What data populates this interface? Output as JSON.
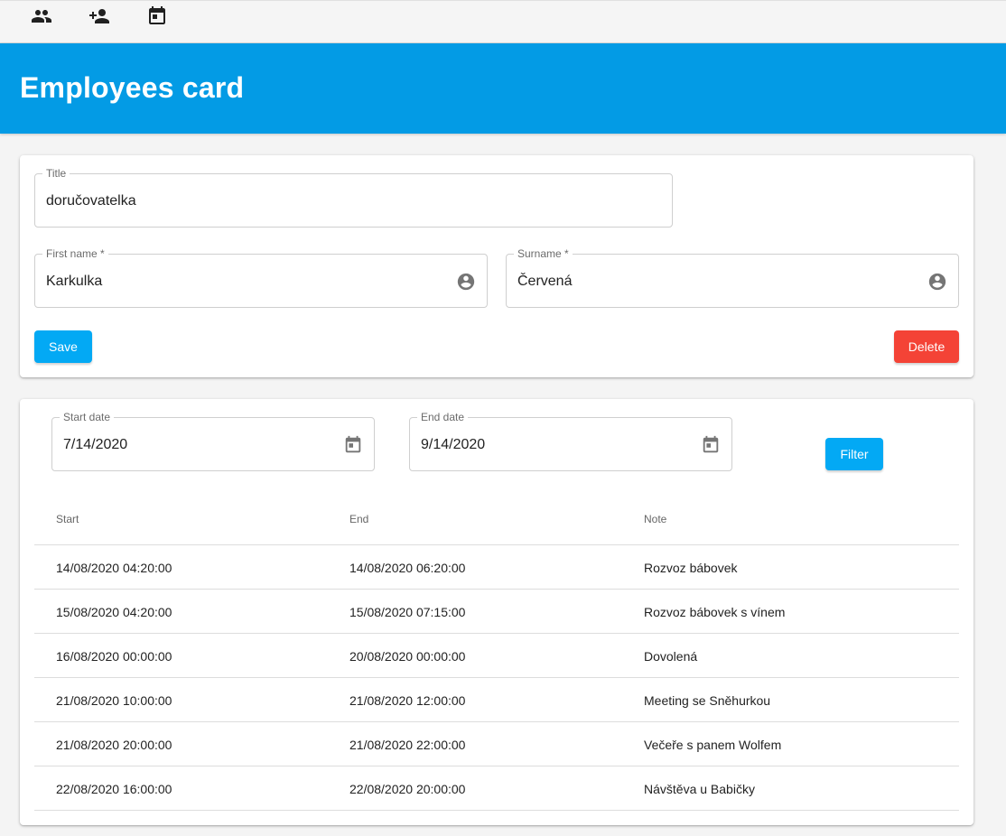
{
  "nav": {
    "icons": [
      "people-icon",
      "person-add-icon",
      "calendar-icon"
    ]
  },
  "header": {
    "title": "Employees card"
  },
  "form": {
    "title_field": {
      "label": "Title",
      "value": "doručovatelka"
    },
    "first_name_field": {
      "label": "First name *",
      "value": "Karkulka",
      "icon": "account-circle-icon"
    },
    "surname_field": {
      "label": "Surname *",
      "value": "Červená",
      "icon": "account-circle-icon"
    },
    "save_label": "Save",
    "delete_label": "Delete"
  },
  "filter": {
    "start_date": {
      "label": "Start date",
      "value": "7/14/2020",
      "icon": "calendar-icon"
    },
    "end_date": {
      "label": "End date",
      "value": "9/14/2020",
      "icon": "calendar-icon"
    },
    "filter_label": "Filter"
  },
  "table": {
    "columns": [
      "Start",
      "End",
      "Note"
    ],
    "rows": [
      [
        "14/08/2020 04:20:00",
        "14/08/2020 06:20:00",
        "Rozvoz bábovek"
      ],
      [
        "15/08/2020 04:20:00",
        "15/08/2020 07:15:00",
        "Rozvoz bábovek s vínem"
      ],
      [
        "16/08/2020 00:00:00",
        "20/08/2020 00:00:00",
        "Dovolená"
      ],
      [
        "21/08/2020 10:00:00",
        "21/08/2020 12:00:00",
        "Meeting se Sněhurkou"
      ],
      [
        "21/08/2020 20:00:00",
        "21/08/2020 22:00:00",
        "Večeře s panem Wolfem"
      ],
      [
        "22/08/2020 16:00:00",
        "22/08/2020 20:00:00",
        "Návštěva u Babičky"
      ]
    ]
  },
  "colors": {
    "header_bg": "#039be5",
    "primary_button": "#03a9f4",
    "danger_button": "#f44336"
  }
}
